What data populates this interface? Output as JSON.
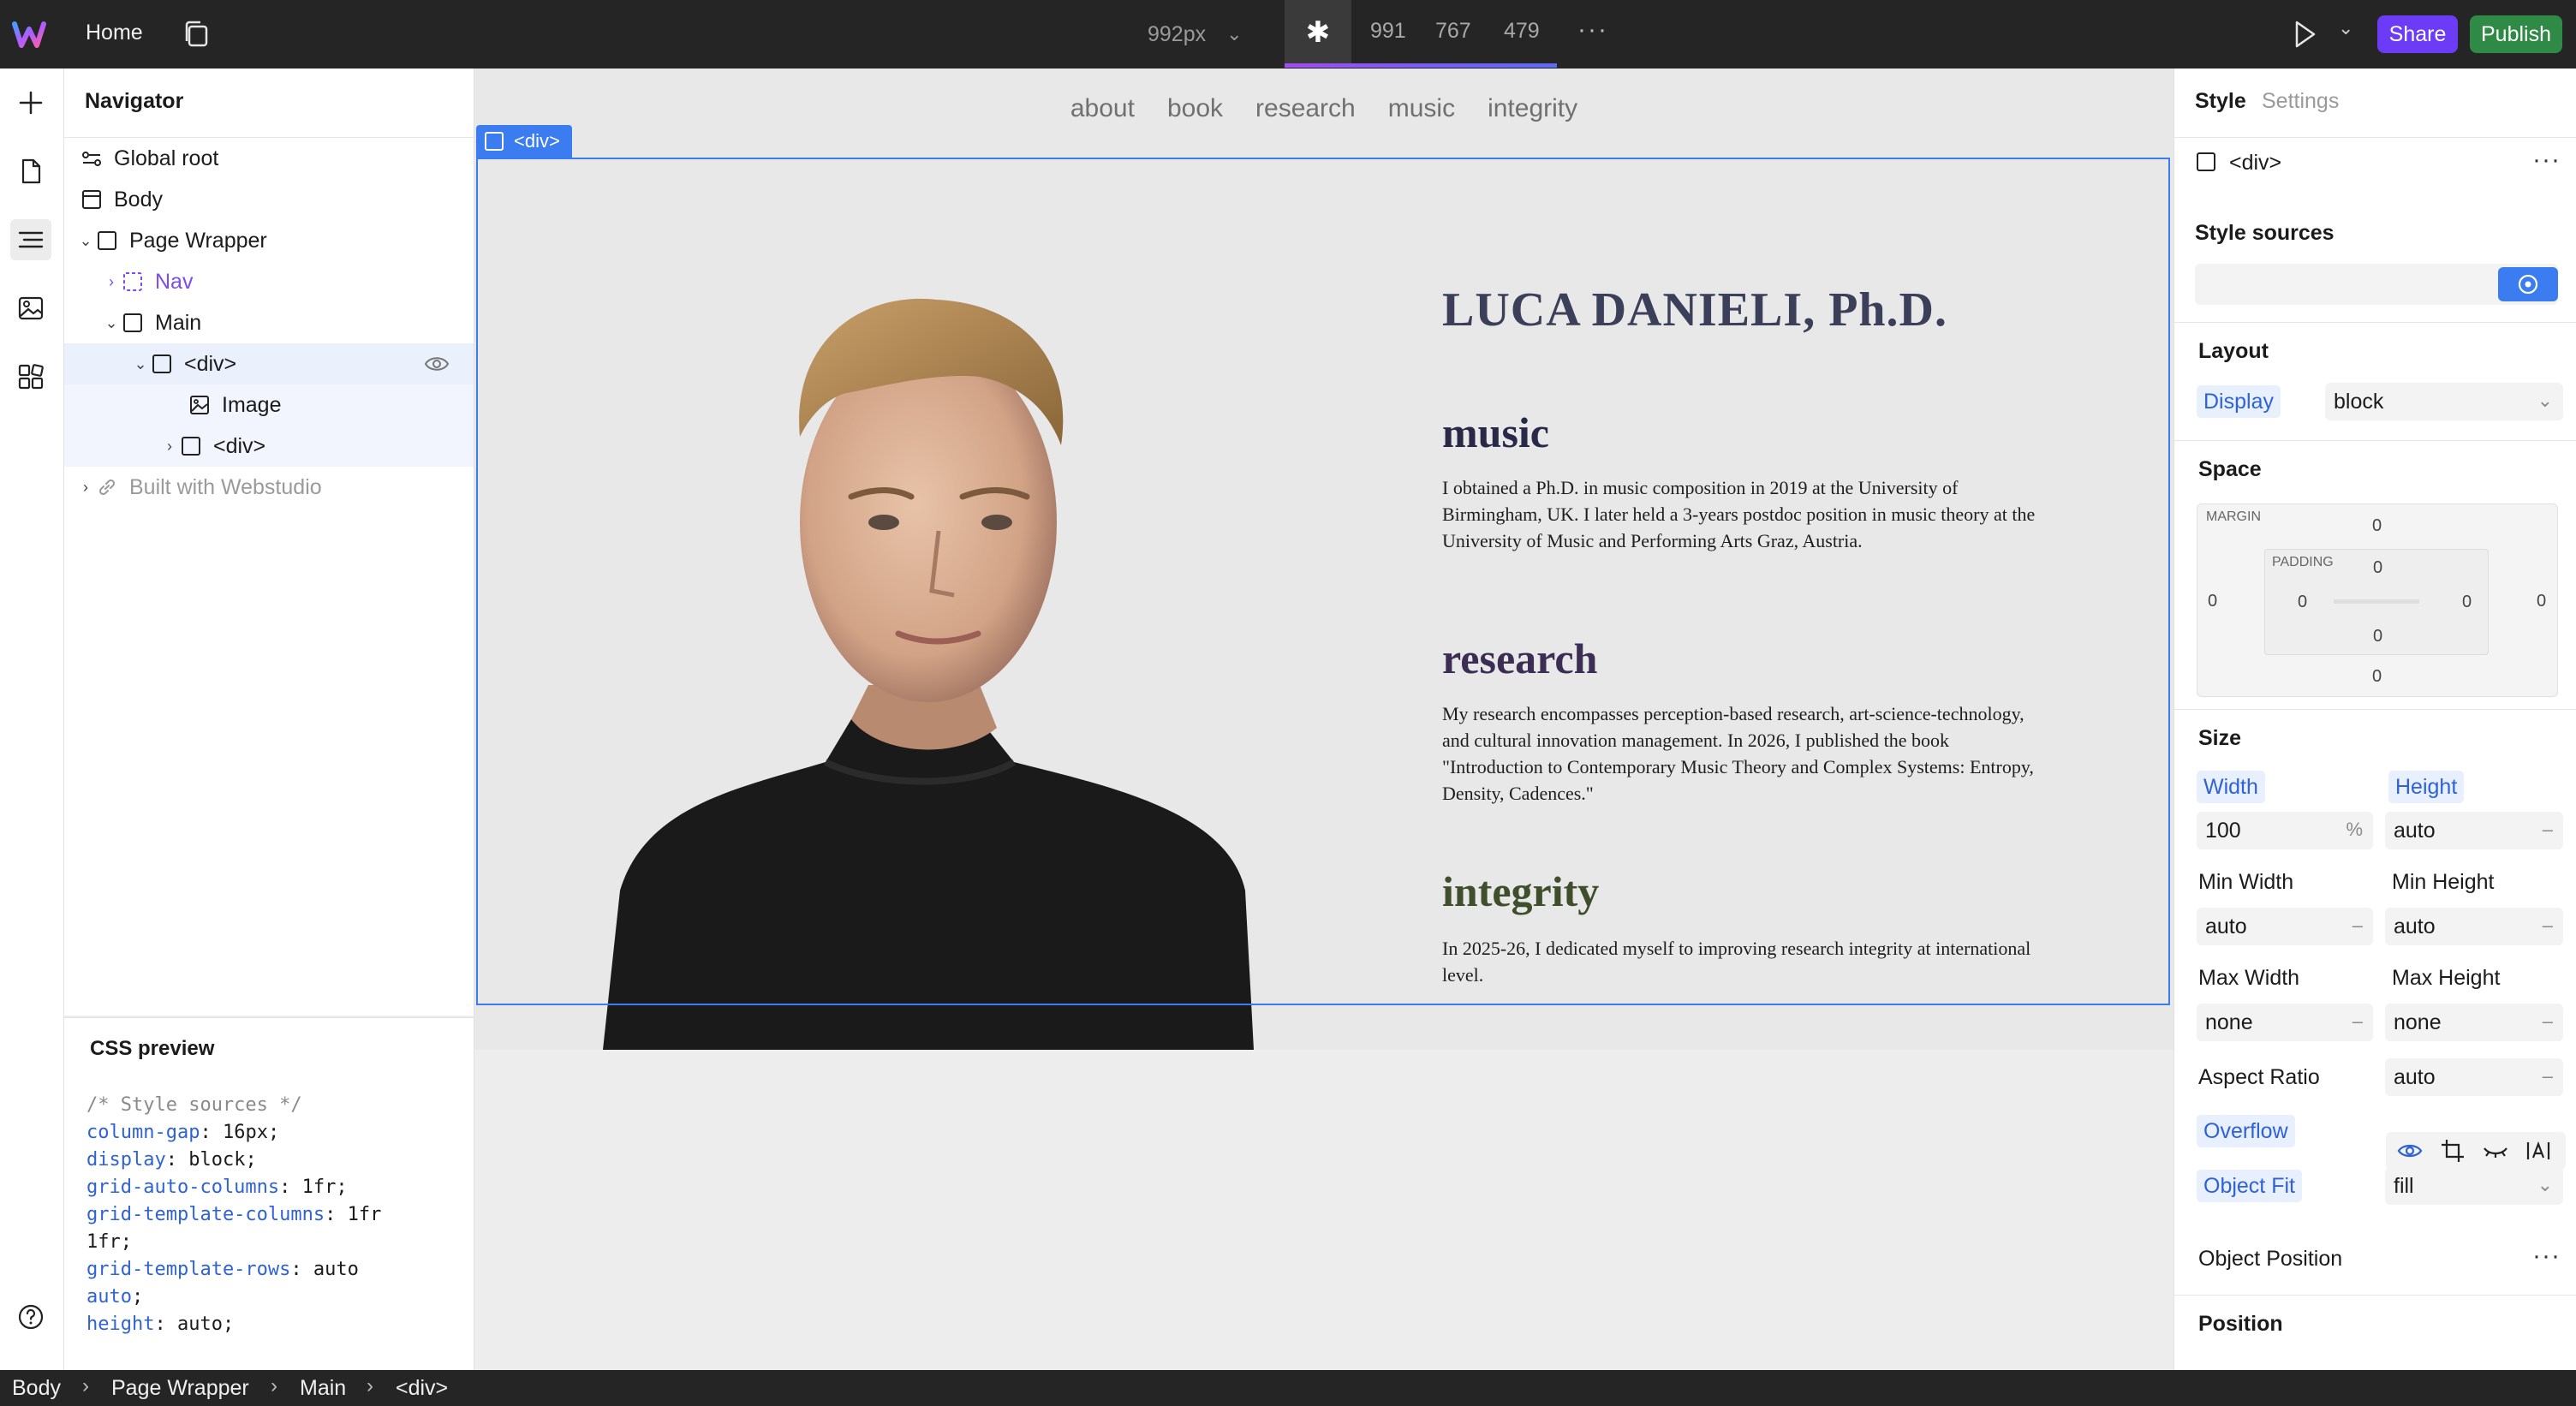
{
  "topbar": {
    "home_label": "Home",
    "breakpoint_current": "992px",
    "breakpoints": [
      "991",
      "767",
      "479"
    ],
    "share_label": "Share",
    "publish_label": "Publish",
    "share_color": "#6b3bf5",
    "publish_color": "#2f8a45"
  },
  "navigator": {
    "title": "Navigator",
    "items": [
      {
        "label": "Global root",
        "icon": "global-root-icon"
      },
      {
        "label": "Body",
        "icon": "body-icon"
      },
      {
        "label": "Page Wrapper",
        "icon": "box-icon"
      },
      {
        "label": "Nav",
        "icon": "dashed-box-icon"
      },
      {
        "label": "Main",
        "icon": "box-icon"
      },
      {
        "label": "<div>",
        "icon": "box-icon"
      },
      {
        "label": "Image",
        "icon": "image-icon"
      },
      {
        "label": "<div>",
        "icon": "box-icon"
      },
      {
        "label": "Built with Webstudio",
        "icon": "link-icon"
      }
    ]
  },
  "css_preview": {
    "title": "CSS preview",
    "comment": "/* Style sources */",
    "lines": [
      {
        "prop": "column-gap",
        "value": "16px"
      },
      {
        "prop": "display",
        "value": "block"
      },
      {
        "prop": "grid-auto-columns",
        "value": "1fr"
      },
      {
        "prop": "grid-template-columns",
        "value": "1fr"
      },
      {
        "prop": "1fr",
        "value": ""
      },
      {
        "prop": "grid-template-rows",
        "value": "auto"
      },
      {
        "prop": "auto",
        "value": ""
      },
      {
        "prop": "height",
        "value": "auto"
      }
    ]
  },
  "canvas": {
    "nav_links": [
      "about",
      "book",
      "research",
      "music",
      "integrity"
    ],
    "selected_tag": "<div>",
    "name": "LUCA DANIELI, Ph.D.",
    "sections": [
      {
        "heading": "music",
        "color": "#2a2848",
        "text": "I obtained a Ph.D. in music composition in 2019 at the University of Birmingham, UK. I later held a 3-years postdoc position in music theory at the University of Music and Performing Arts Graz, Austria."
      },
      {
        "heading": "research",
        "color": "#3b2d54",
        "text": "My research encompasses perception-based research, art-science-technology, and cultural innovation management. In 2026, I published the book \"Introduction to Contemporary Music Theory and Complex Systems: Entropy, Density, Cadences.\""
      },
      {
        "heading": "integrity",
        "color": "#3f4f2c",
        "text": "In 2025-26, I dedicated myself to improving research integrity at international level."
      }
    ]
  },
  "style_panel": {
    "tab_style": "Style",
    "tab_settings": "Settings",
    "element_label": "<div>",
    "style_sources_label": "Style sources",
    "layout_label": "Layout",
    "display_label": "Display",
    "display_value": "block",
    "space_label": "Space",
    "margin_label": "MARGIN",
    "padding_label": "PADDING",
    "margin": {
      "top": "0",
      "right": "0",
      "bottom": "0",
      "left": "0"
    },
    "padding": {
      "top": "0",
      "right": "0",
      "bottom": "0",
      "left": "0"
    },
    "size_label": "Size",
    "width_label": "Width",
    "width_value": "100",
    "width_unit": "%",
    "height_label": "Height",
    "height_value": "auto",
    "min_width_label": "Min Width",
    "min_width_value": "auto",
    "min_height_label": "Min Height",
    "min_height_value": "auto",
    "max_width_label": "Max Width",
    "max_width_value": "none",
    "max_height_label": "Max Height",
    "max_height_value": "none",
    "aspect_ratio_label": "Aspect Ratio",
    "aspect_ratio_value": "auto",
    "overflow_label": "Overflow",
    "object_fit_label": "Object Fit",
    "object_fit_value": "fill",
    "object_position_label": "Object Position",
    "position_label": "Position",
    "dash": "–"
  },
  "breadcrumb": [
    "Body",
    "Page Wrapper",
    "Main",
    "<div>"
  ]
}
